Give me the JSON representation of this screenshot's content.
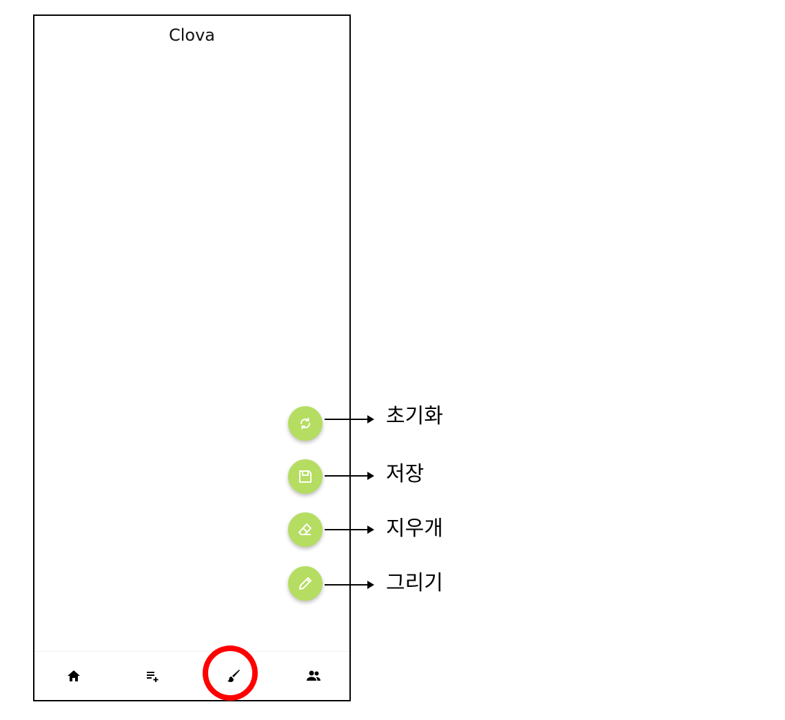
{
  "app": {
    "title": "Clova"
  },
  "fabs": [
    {
      "name": "reset",
      "icon": "refresh-icon",
      "label": "초기화"
    },
    {
      "name": "save",
      "icon": "save-icon",
      "label": "저장"
    },
    {
      "name": "eraser",
      "icon": "eraser-icon",
      "label": "지우개"
    },
    {
      "name": "draw",
      "icon": "pencil-icon",
      "label": "그리기"
    }
  ],
  "bottom_nav": [
    {
      "name": "home",
      "icon": "home-icon"
    },
    {
      "name": "playlist-add",
      "icon": "playlist-add-icon"
    },
    {
      "name": "brush",
      "icon": "brush-icon",
      "highlighted": true
    },
    {
      "name": "people",
      "icon": "people-icon"
    }
  ],
  "colors": {
    "fab": "#b5dd62",
    "highlight": "#ff0000"
  }
}
